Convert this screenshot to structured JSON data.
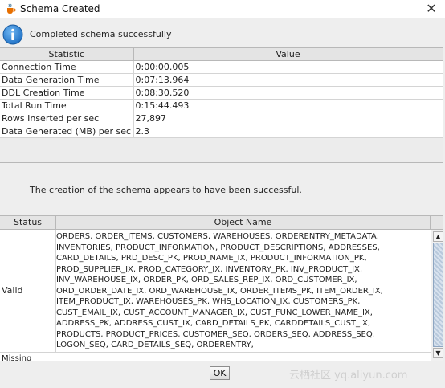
{
  "window": {
    "title": "Schema Created",
    "close_glyph": "✕"
  },
  "info": {
    "icon": "info-icon",
    "message": "Completed schema successfully"
  },
  "stats": {
    "headers": [
      "Statistic",
      "Value"
    ],
    "rows": [
      {
        "name": "Connection Time",
        "value": "0:00:00.005"
      },
      {
        "name": "Data Generation Time",
        "value": "0:07:13.964"
      },
      {
        "name": "DDL Creation Time",
        "value": "0:08:30.520"
      },
      {
        "name": "Total Run Time",
        "value": "0:15:44.493"
      },
      {
        "name": "Rows Inserted per sec",
        "value": "27,897"
      },
      {
        "name": "Data Generated (MB) per sec",
        "value": "2.3"
      }
    ]
  },
  "result_message": "The creation of the schema appears to have been successful.",
  "objects": {
    "headers": [
      "Status",
      "Object Name"
    ],
    "valid": {
      "status": "Valid",
      "names": "ORDERS, ORDER_ITEMS, CUSTOMERS, WAREHOUSES, ORDERENTRY_METADATA,\nINVENTORIES, PRODUCT_INFORMATION, PRODUCT_DESCRIPTIONS, ADDRESSES,\nCARD_DETAILS, PRD_DESC_PK, PROD_NAME_IX, PRODUCT_INFORMATION_PK,\nPROD_SUPPLIER_IX, PROD_CATEGORY_IX, INVENTORY_PK, INV_PRODUCT_IX,\nINV_WAREHOUSE_IX, ORDER_PK, ORD_SALES_REP_IX, ORD_CUSTOMER_IX,\nORD_ORDER_DATE_IX, ORD_WAREHOUSE_IX, ORDER_ITEMS_PK, ITEM_ORDER_IX,\nITEM_PRODUCT_IX, WAREHOUSES_PK, WHS_LOCATION_IX, CUSTOMERS_PK,\nCUST_EMAIL_IX, CUST_ACCOUNT_MANAGER_IX, CUST_FUNC_LOWER_NAME_IX,\nADDRESS_PK, ADDRESS_CUST_IX, CARD_DETAILS_PK, CARDDETAILS_CUST_IX,\nPRODUCTS, PRODUCT_PRICES, CUSTOMER_SEQ, ORDERS_SEQ, ADDRESS_SEQ,\nLOGON_SEQ, CARD_DETAILS_SEQ, ORDERENTRY,"
    },
    "missing": {
      "status": "Missing"
    }
  },
  "footer": {
    "ok_label": "OK"
  },
  "watermark": "云栖社区 yq.aliyun.com"
}
